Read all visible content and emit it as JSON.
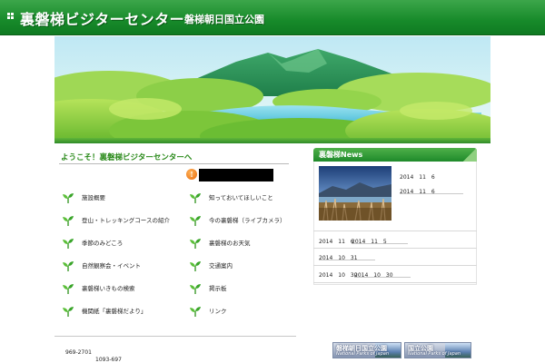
{
  "header": {
    "title": "裏磐梯ビジターセンター",
    "subtitle": "磐梯朝日国立公園"
  },
  "colors": {
    "brand_green": "#178a2a",
    "accent_green": "#2a8a1a",
    "notice_orange": "#e86a0a"
  },
  "welcome": {
    "heading": "ようこそ！裏磐梯ビジターセンターへ"
  },
  "nav": {
    "left": [
      {
        "label": "施設概要",
        "icon": "sprout-icon"
      },
      {
        "label": "登山・トレッキングコースの紹介",
        "icon": "sprout-icon"
      },
      {
        "label": "季節のみどころ",
        "icon": "sprout-icon"
      },
      {
        "label": "自然観察会・イベント",
        "icon": "sprout-icon"
      },
      {
        "label": "裏磐梯いきもの検索",
        "icon": "sprout-icon"
      },
      {
        "label": "機関紙「裏磐梯だより」",
        "icon": "sprout-icon"
      }
    ],
    "right": [
      {
        "label": "知っておいてほしいこと",
        "icon": "sprout-icon"
      },
      {
        "label": "今の裏磐梯（ライブカメラ）",
        "icon": "sprout-icon"
      },
      {
        "label": "裏磐梯のお天気",
        "icon": "sprout-icon"
      },
      {
        "label": "交通案内",
        "icon": "sprout-icon"
      },
      {
        "label": "掲示板",
        "icon": "sprout-icon"
      },
      {
        "label": "リンク",
        "icon": "sprout-icon"
      }
    ]
  },
  "footer": {
    "postal": "969-2701",
    "address": "1093-697"
  },
  "news": {
    "title": "裏磐梯News",
    "photo_items": [
      "2014　11　6",
      "2014　11　6"
    ],
    "rows": [
      {
        "date": "2014　11　6",
        "date2": "2014　11　5"
      },
      {
        "date": "2014　10　31",
        "date2": ""
      },
      {
        "date": "2014　10　30",
        "date2": "2014　10　30"
      }
    ]
  },
  "banners": [
    {
      "jp": "磐梯朝日国立公園",
      "en": "National Parks of Japan"
    },
    {
      "jp": "国立公園",
      "en": "National Parks of Japan"
    }
  ]
}
